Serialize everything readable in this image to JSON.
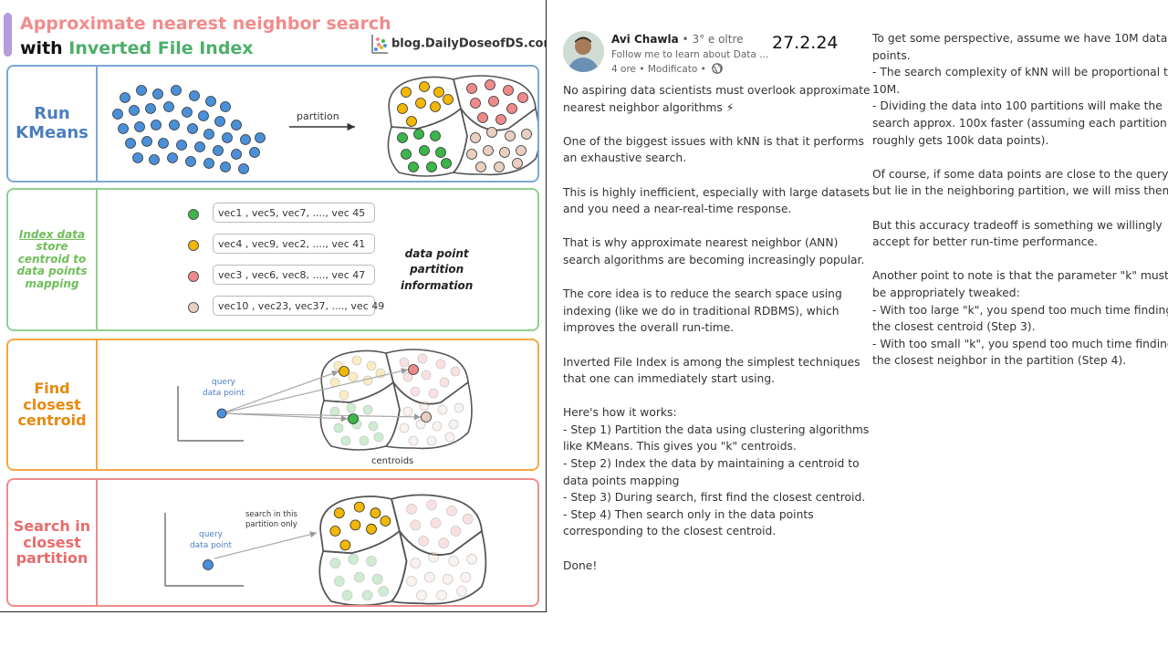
{
  "infographic": {
    "title_line1": "Approximate nearest neighbor search",
    "title_line2_prefix": "with ",
    "title_line2_accent": "Inverted File Index",
    "brand": "blog.DailyDoseofDS.com",
    "colors": {
      "blue": "#4a90d9",
      "yellow": "#f2b705",
      "red": "#ee8a8a",
      "green": "#3cb54a",
      "beige": "#e8cfc0"
    },
    "sections": [
      {
        "label_lines": [
          "Run",
          "KMeans"
        ],
        "arrow_label": "partition"
      },
      {
        "label_lines": [
          "Index data",
          "store",
          "centroid to",
          "data points",
          "mapping"
        ],
        "side_note_lines": [
          "data point",
          "partition",
          "information"
        ],
        "mappings": [
          {
            "color": "green",
            "text": "vec1 , vec5, vec7, ...., vec 45"
          },
          {
            "color": "yellow",
            "text": "vec4 , vec9, vec2, ...., vec 41"
          },
          {
            "color": "red",
            "text": "vec3 , vec6, vec8, ...., vec 47"
          },
          {
            "color": "beige",
            "text": "vec10 , vec23, vec37, ...., vec 49"
          }
        ]
      },
      {
        "label_lines": [
          "Find",
          "closest",
          "centroid"
        ],
        "query_lines": [
          "query",
          "data point"
        ],
        "centroids_label": "centroids"
      },
      {
        "label_lines": [
          "Search in",
          "closest",
          "partition"
        ],
        "query_lines": [
          "query",
          "data point"
        ],
        "note_lines": [
          "search in this",
          "partition only"
        ]
      }
    ]
  },
  "post": {
    "author": "Avi Chawla",
    "degree": "• 3° e oltre",
    "headline": "Follow me to learn about Data ...",
    "meta": "4 ore • Modificato •",
    "globe_icon": "globe-icon",
    "date_stamp": "27.2.24",
    "col1_paragraphs": [
      [
        "No aspiring data scientists must overlook approximate",
        "nearest neighbor algorithms ⚡"
      ],
      [
        "One of the biggest issues with kNN is that it performs",
        "an exhaustive search."
      ],
      [
        "This is highly inefficient, especially with large datasets",
        "and you need a near-real-time response."
      ],
      [
        "That is why approximate nearest neighbor (ANN)",
        "search algorithms are becoming increasingly popular."
      ],
      [
        "The core idea is to reduce the search space using",
        "indexing (like we do in traditional RDBMS), which",
        "improves the overall run-time."
      ],
      [
        "Inverted File Index is among the simplest techniques",
        "that one can immediately start using."
      ],
      [
        "Here's how it works:",
        "- Step 1) Partition the data using clustering algorithms",
        "like KMeans. This gives you \"k\" centroids.",
        "- Step 2) Index the data by maintaining a centroid to",
        "data points mapping",
        "- Step 3) During search, first find the closest centroid.",
        "- Step 4) Then search only in the data points",
        "corresponding to the closest centroid."
      ],
      [
        "Done!"
      ]
    ],
    "col2_paragraphs": [
      [
        "To get some perspective, assume we have 10M data",
        "points.",
        "- The search complexity of kNN will be proportional to",
        "10M.",
        "- Dividing the data into 100 partitions will make the",
        "search approx. 100x faster (assuming each partition",
        "roughly gets 100k data points)."
      ],
      [
        "Of course, if some data points are close to the query",
        "but lie in the neighboring partition, we will miss them."
      ],
      [
        "But this accuracy tradeoff is something we willingly",
        "accept for better run-time performance."
      ],
      [
        "Another point to note is that the parameter \"k\" must",
        "be appropriately tweaked:",
        "- With too large \"k\", you spend too much time finding",
        "the closest centroid (Step 3).",
        "- With too small \"k\", you spend too much time finding",
        "the closest neighbor in the partition (Step 4)."
      ]
    ]
  }
}
